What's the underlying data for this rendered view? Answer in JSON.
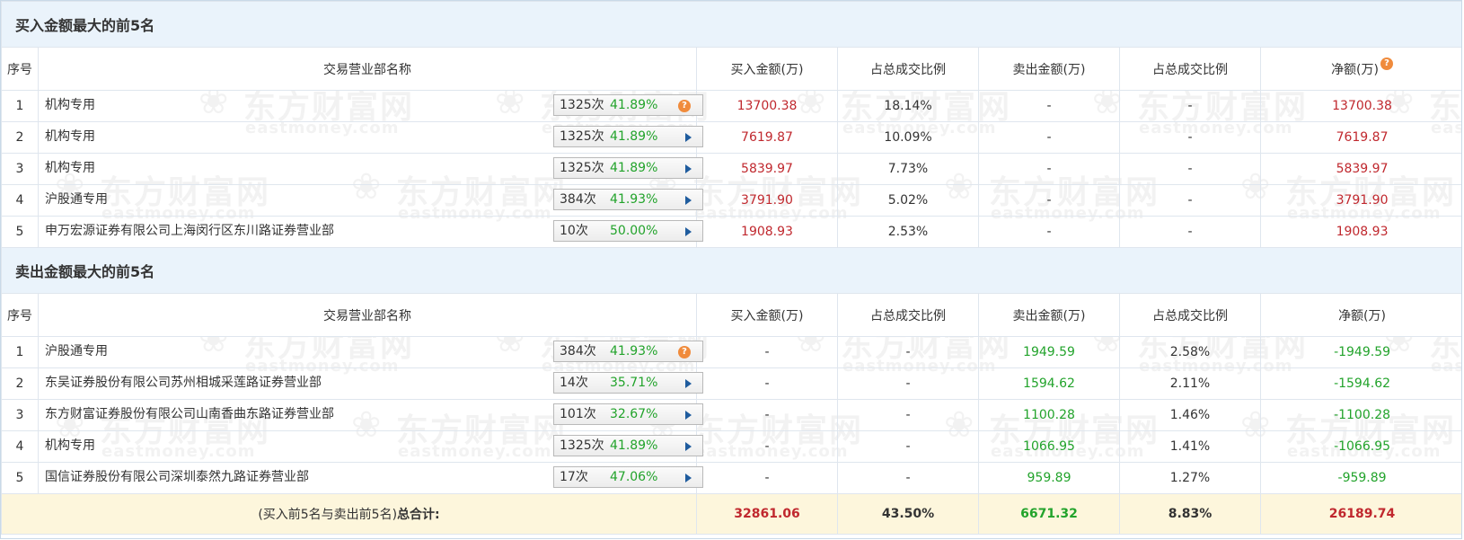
{
  "colors": {
    "section_header_bg": "#eaf3fb",
    "positive": "#c0282e",
    "negative": "#22a32b",
    "total_row_bg": "#fdf6dc",
    "badge_orange": "#f08b3c"
  },
  "watermark": {
    "cn": "东方财富网",
    "en": "eastmoney.com"
  },
  "icons": {
    "help": "?",
    "row_stat_icons": [
      "help-icon",
      "arrow-right-icon"
    ]
  },
  "columns": {
    "seq": "序号",
    "name": "交易营业部名称",
    "buy_amount": "买入金额(万)",
    "buy_ratio": "占总成交比例",
    "sell_amount": "卖出金额(万)",
    "sell_ratio": "占总成交比例",
    "net": "净额(万)"
  },
  "buy_section": {
    "title": "买入金额最大的前5名",
    "rows": [
      {
        "seq": "1",
        "name": "机构专用",
        "count": "1325次",
        "pct": "41.89%",
        "icon": "help",
        "buy": "13700.38",
        "buy_ratio": "18.14%",
        "sell": "-",
        "sell_ratio": "-",
        "net": "13700.38"
      },
      {
        "seq": "2",
        "name": "机构专用",
        "count": "1325次",
        "pct": "41.89%",
        "icon": "arrow",
        "buy": "7619.87",
        "buy_ratio": "10.09%",
        "sell": "-",
        "sell_ratio": "-",
        "net": "7619.87"
      },
      {
        "seq": "3",
        "name": "机构专用",
        "count": "1325次",
        "pct": "41.89%",
        "icon": "arrow",
        "buy": "5839.97",
        "buy_ratio": "7.73%",
        "sell": "-",
        "sell_ratio": "-",
        "net": "5839.97"
      },
      {
        "seq": "4",
        "name": "沪股通专用",
        "count": "384次",
        "pct": "41.93%",
        "icon": "arrow",
        "buy": "3791.90",
        "buy_ratio": "5.02%",
        "sell": "-",
        "sell_ratio": "-",
        "net": "3791.90"
      },
      {
        "seq": "5",
        "name": "申万宏源证券有限公司上海闵行区东川路证券营业部",
        "count": "10次",
        "pct": "50.00%",
        "icon": "arrow",
        "buy": "1908.93",
        "buy_ratio": "2.53%",
        "sell": "-",
        "sell_ratio": "-",
        "net": "1908.93"
      }
    ]
  },
  "sell_section": {
    "title": "卖出金额最大的前5名",
    "rows": [
      {
        "seq": "1",
        "name": "沪股通专用",
        "count": "384次",
        "pct": "41.93%",
        "icon": "help",
        "buy": "-",
        "buy_ratio": "-",
        "sell": "1949.59",
        "sell_ratio": "2.58%",
        "net": "-1949.59"
      },
      {
        "seq": "2",
        "name": "东吴证券股份有限公司苏州相城采莲路证券营业部",
        "count": "14次",
        "pct": "35.71%",
        "icon": "arrow",
        "buy": "-",
        "buy_ratio": "-",
        "sell": "1594.62",
        "sell_ratio": "2.11%",
        "net": "-1594.62"
      },
      {
        "seq": "3",
        "name": "东方财富证券股份有限公司山南香曲东路证券营业部",
        "count": "101次",
        "pct": "32.67%",
        "icon": "arrow",
        "buy": "-",
        "buy_ratio": "-",
        "sell": "1100.28",
        "sell_ratio": "1.46%",
        "net": "-1100.28"
      },
      {
        "seq": "4",
        "name": "机构专用",
        "count": "1325次",
        "pct": "41.89%",
        "icon": "arrow",
        "buy": "-",
        "buy_ratio": "-",
        "sell": "1066.95",
        "sell_ratio": "1.41%",
        "net": "-1066.95"
      },
      {
        "seq": "5",
        "name": "国信证券股份有限公司深圳泰然九路证券营业部",
        "count": "17次",
        "pct": "47.06%",
        "icon": "arrow",
        "buy": "-",
        "buy_ratio": "-",
        "sell": "959.89",
        "sell_ratio": "1.27%",
        "net": "-959.89"
      }
    ]
  },
  "total": {
    "label_prefix": "(买入前5名与卖出前5名)",
    "label_bold": "总合计:",
    "buy": "32861.06",
    "buy_ratio": "43.50%",
    "sell": "6671.32",
    "sell_ratio": "8.83%",
    "net": "26189.74"
  }
}
